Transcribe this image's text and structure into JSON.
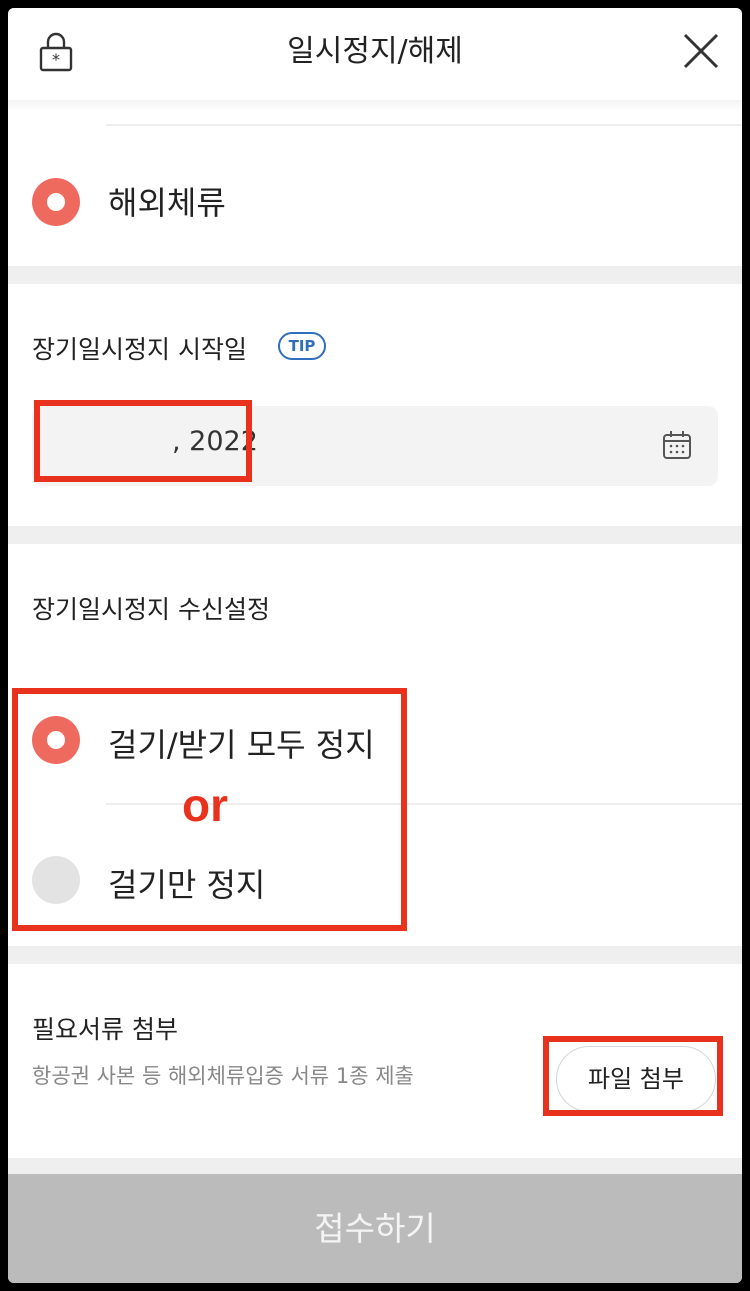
{
  "header": {
    "title": "일시정지/해제"
  },
  "reason": {
    "selected_label": "해외체류"
  },
  "start_date": {
    "label": "장기일시정지 시작일",
    "tip_label": "TIP",
    "value": ", 2022"
  },
  "reception": {
    "label": "장기일시정지 수신설정",
    "options": [
      {
        "label": "걸기/받기 모두 정지",
        "selected": true
      },
      {
        "label": "걸기만 정지",
        "selected": false
      }
    ],
    "annotation": "or"
  },
  "documents": {
    "title": "필요서류 첨부",
    "description": "항공권 사본 등 해외체류입증 서류 1종 제출",
    "attach_button": "파일 첨부"
  },
  "submit_label": "접수하기",
  "colors": {
    "accent": "#ef6a5e",
    "highlight": "#e8321e",
    "tip": "#2f6fbd",
    "disabled": "#bbbbbb"
  }
}
